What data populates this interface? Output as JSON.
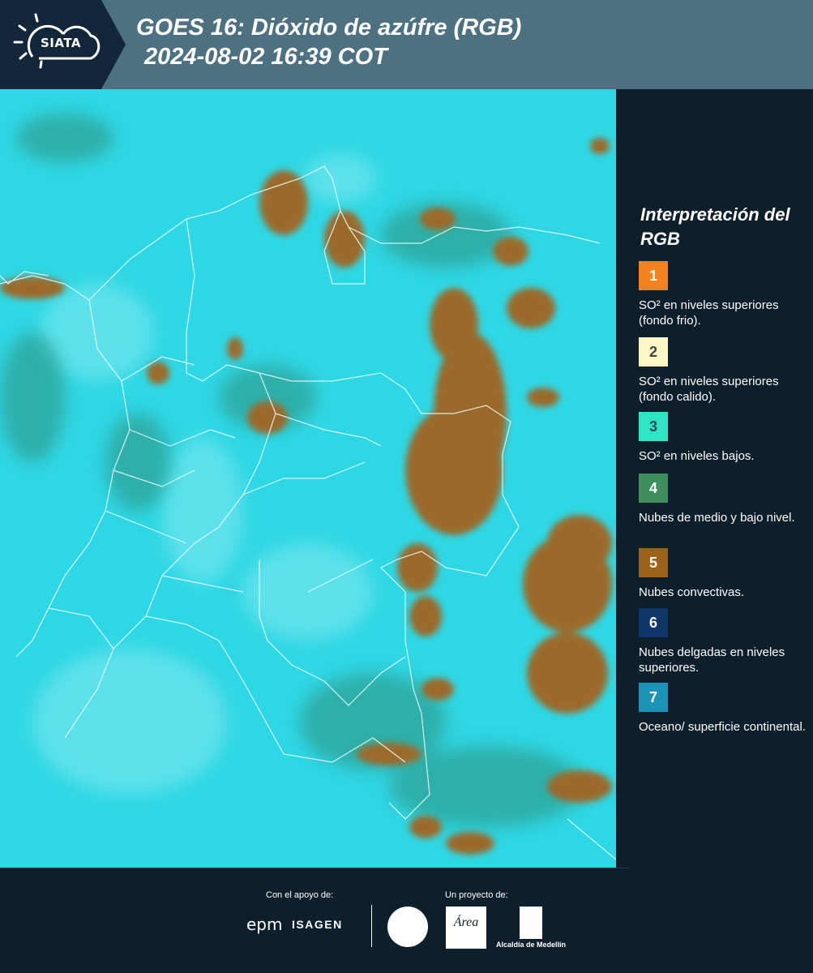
{
  "header": {
    "logo_text": "SIATA",
    "title_line1": "GOES 16: Dióxido de azúfre (RGB)",
    "title_line2": "2024-08-02 16:39 COT"
  },
  "legend": {
    "title": "Interpretación del RGB",
    "items": [
      {
        "number": "1",
        "color": "#f5821f",
        "text_color": "#ffffff",
        "label": "SO² en niveles superiores (fondo frio)."
      },
      {
        "number": "2",
        "color": "#fff6c4",
        "text_color": "#444444",
        "label": "SO² en niveles superiores (fondo calido)."
      },
      {
        "number": "3",
        "color": "#2ee6c6",
        "text_color": "#2b4b55",
        "label": "SO² en niveles bajos."
      },
      {
        "number": "4",
        "color": "#3f8f5e",
        "text_color": "#ffffff",
        "label": "Nubes de medio y bajo nivel."
      },
      {
        "number": "5",
        "color": "#9b6319",
        "text_color": "#ffffff",
        "label": "Nubes convectivas."
      },
      {
        "number": "6",
        "color": "#0f3668",
        "text_color": "#ffffff",
        "label": "Nubes delgadas en niveles superiores."
      },
      {
        "number": "7",
        "color": "#1c93b8",
        "text_color": "#ffffff",
        "label": "Oceano/ superficie continental."
      }
    ]
  },
  "footer": {
    "support_label": "Con el apoyo de:",
    "project_label": "Un proyecto de:",
    "epm": "epm",
    "isagen": "ISAGEN",
    "area": "Área",
    "alcaldia": "Alcaldía de Medellín"
  },
  "colors": {
    "background": "#0e1f2c",
    "header": "#4d7180",
    "ocean_land": "#2ed7e4",
    "convective_clouds": "#9b6a2c"
  }
}
